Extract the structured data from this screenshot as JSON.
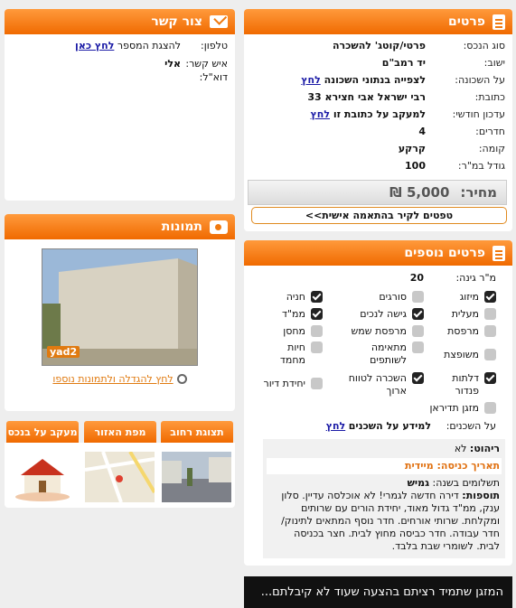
{
  "details": {
    "title": "פרטים",
    "rows": [
      {
        "label": "סוג הנכס:",
        "value": "פרטי/קוטג' להשכרה"
      },
      {
        "label": "ישוב:",
        "value": "יד רמב\"ם"
      },
      {
        "label": "על השכונה:",
        "value": "לצפייה בנתוני השכונה",
        "link": "לחץ"
      },
      {
        "label": "כתובת:",
        "value": "רבי ישראל אבי חצירא 33"
      },
      {
        "label": "עדכון חודשי:",
        "value": "למעקב על כתובת זו",
        "link": "לחץ"
      },
      {
        "label": "חדרים:",
        "value": "4"
      },
      {
        "label": "קומה:",
        "value": "קרקע"
      },
      {
        "label": "גודל במ\"ר:",
        "value": "100"
      }
    ],
    "price_label": "מחיר:",
    "price_value": "5,000 ₪",
    "tips_button": "טפטים לקיר בהתאמה אישית>>"
  },
  "contact": {
    "title": "צור קשר",
    "phone_label": "טלפון:",
    "phone_text": "להצגת המספר",
    "phone_link": "לחץ כאן",
    "person_label": "איש קשר:",
    "person_value": "אלי",
    "email_label": "דוא\"ל:"
  },
  "photos": {
    "title": "תמונות",
    "watermark": "yad2",
    "enlarge_link": "לחץ להגדלה ולתמונות נוספו"
  },
  "tabs": {
    "street_view": "תצוגת רחוב",
    "area_map": "מפת האזור",
    "tracking": "מעקב על בנכס"
  },
  "more_details": {
    "title": "פרטים נוספים",
    "garden_label": "מ\"ר גינה:",
    "garden_value": "20",
    "features": [
      {
        "label": "מיזוג",
        "checked": true
      },
      {
        "label": "סורגים",
        "checked": false
      },
      {
        "label": "חניה",
        "checked": true
      },
      {
        "label": "מעלית",
        "checked": false
      },
      {
        "label": "גישה לנכים",
        "checked": true
      },
      {
        "label": "ממ\"ד",
        "checked": true
      },
      {
        "label": "מרפסת",
        "checked": false
      },
      {
        "label": "מרפסת שמש",
        "checked": false
      },
      {
        "label": "מחסן",
        "checked": false
      },
      {
        "label": "משופצת",
        "checked": false
      },
      {
        "label": "מתאימה לשותפים",
        "checked": false
      },
      {
        "label": "חיות מחמד",
        "checked": false
      },
      {
        "label": "דלתות פנדור",
        "checked": true
      },
      {
        "label": "השכרה לטווח ארוך",
        "checked": true
      },
      {
        "label": "יחידת דיור",
        "checked": false
      },
      {
        "label": "מזגן תדיראן",
        "checked": false
      }
    ],
    "neighbors_label": "על השכנים:",
    "neighbors_value": "למידע על השכנים",
    "neighbors_link": "לחץ"
  },
  "info": {
    "furniture_label": "ריהוט:",
    "furniture_value": "לא",
    "entry_date": "תאריך כניסה: מיידית",
    "payments_label": "תשלומים בשנה:",
    "payments_value": "גמיש",
    "extras_label": "תוספות:",
    "extras_text": "דירה חדשה לגמרי! לא אוכלסה עדיין. סלון ענק, ממ\"ד גדול מאוד, יחידת הורים עם שרותים ומקלחת. שרותי אורחים. חדר נוסף המתאים לתינוק/ חדר עבודה. חדר כביסה מחוץ לבית. חצר בכניסה לבית. לשומרי שבת בלבד."
  },
  "banner": {
    "text": "המזגן שתמיד רציתם  בהצעה שעוד לא קיבלתם..."
  },
  "colors": {
    "accent": "#f07a10",
    "link": "#1a1aa6",
    "banner_bg": "#111111"
  }
}
